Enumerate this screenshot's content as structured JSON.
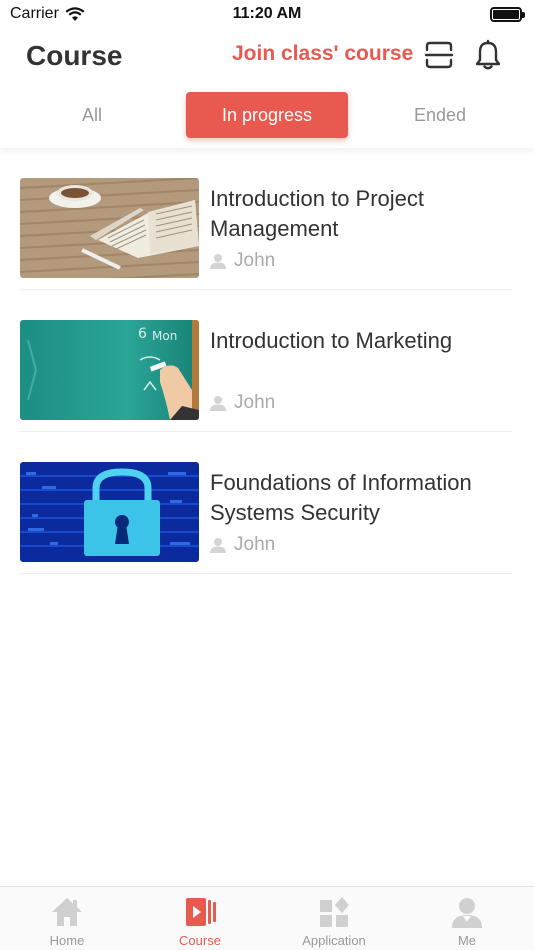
{
  "status": {
    "carrier": "Carrier",
    "time": "11:20 AM"
  },
  "header": {
    "title": "Course",
    "join_link": "Join class' course"
  },
  "tabs": [
    {
      "label": "All",
      "active": false
    },
    {
      "label": "In progress",
      "active": true
    },
    {
      "label": "Ended",
      "active": false
    }
  ],
  "courses": [
    {
      "title": "Introduction to Project Management",
      "author": "John",
      "thumb": "book-coffee"
    },
    {
      "title": "Introduction to Marketing",
      "author": "John",
      "thumb": "chalkboard"
    },
    {
      "title": "Foundations of Information Systems Security",
      "author": "John",
      "thumb": "padlock"
    }
  ],
  "bottom_nav": [
    {
      "label": "Home",
      "icon": "home-icon",
      "active": false
    },
    {
      "label": "Course",
      "icon": "course-icon",
      "active": true
    },
    {
      "label": "Application",
      "icon": "application-icon",
      "active": false
    },
    {
      "label": "Me",
      "icon": "user-icon",
      "active": false
    }
  ],
  "colors": {
    "accent": "#e85a4f",
    "inactive": "#999999"
  }
}
